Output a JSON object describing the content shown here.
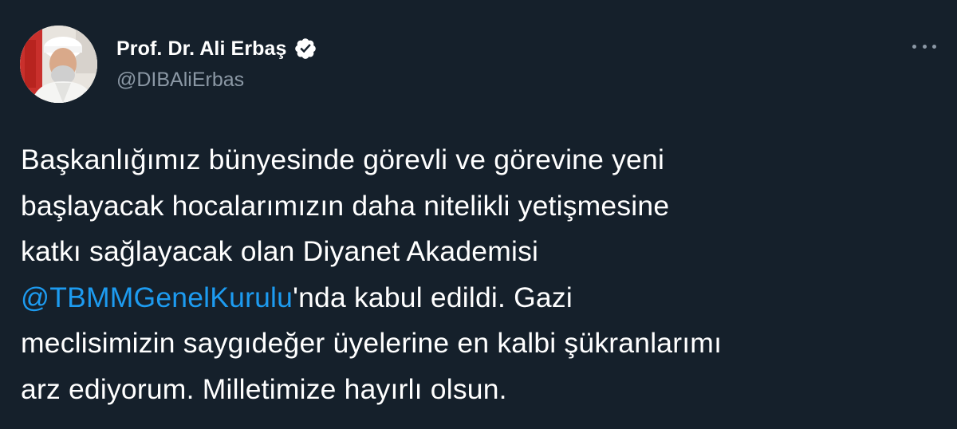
{
  "author": {
    "display_name": "Prof. Dr. Ali Erbaş",
    "handle": "@DIBAliErbas",
    "verified": true,
    "avatar_icon": "profile-photo"
  },
  "tweet": {
    "lines": [
      "Başkanlığımız bünyesinde görevli ve görevine yeni",
      "başlayacak hocalarımızın daha nitelikli yetişmesine",
      "katkı sağlayacak olan Diyanet Akademisi"
    ],
    "mention_line": {
      "mention": "@TBMMGenelKurulu",
      "rest": "'nda kabul edildi. Gazi"
    },
    "lines_after": [
      "meclisimizin saygıdeğer üyelerine en kalbi şükranlarımı",
      "arz ediyorum. Milletimize hayırlı olsun."
    ]
  },
  "icons": {
    "verified": "verified-badge-icon",
    "more": "more-options-icon"
  },
  "colors": {
    "background": "#15202b",
    "text": "#ffffff",
    "secondary_text": "#8b98a5",
    "mention": "#1d9bf0"
  }
}
